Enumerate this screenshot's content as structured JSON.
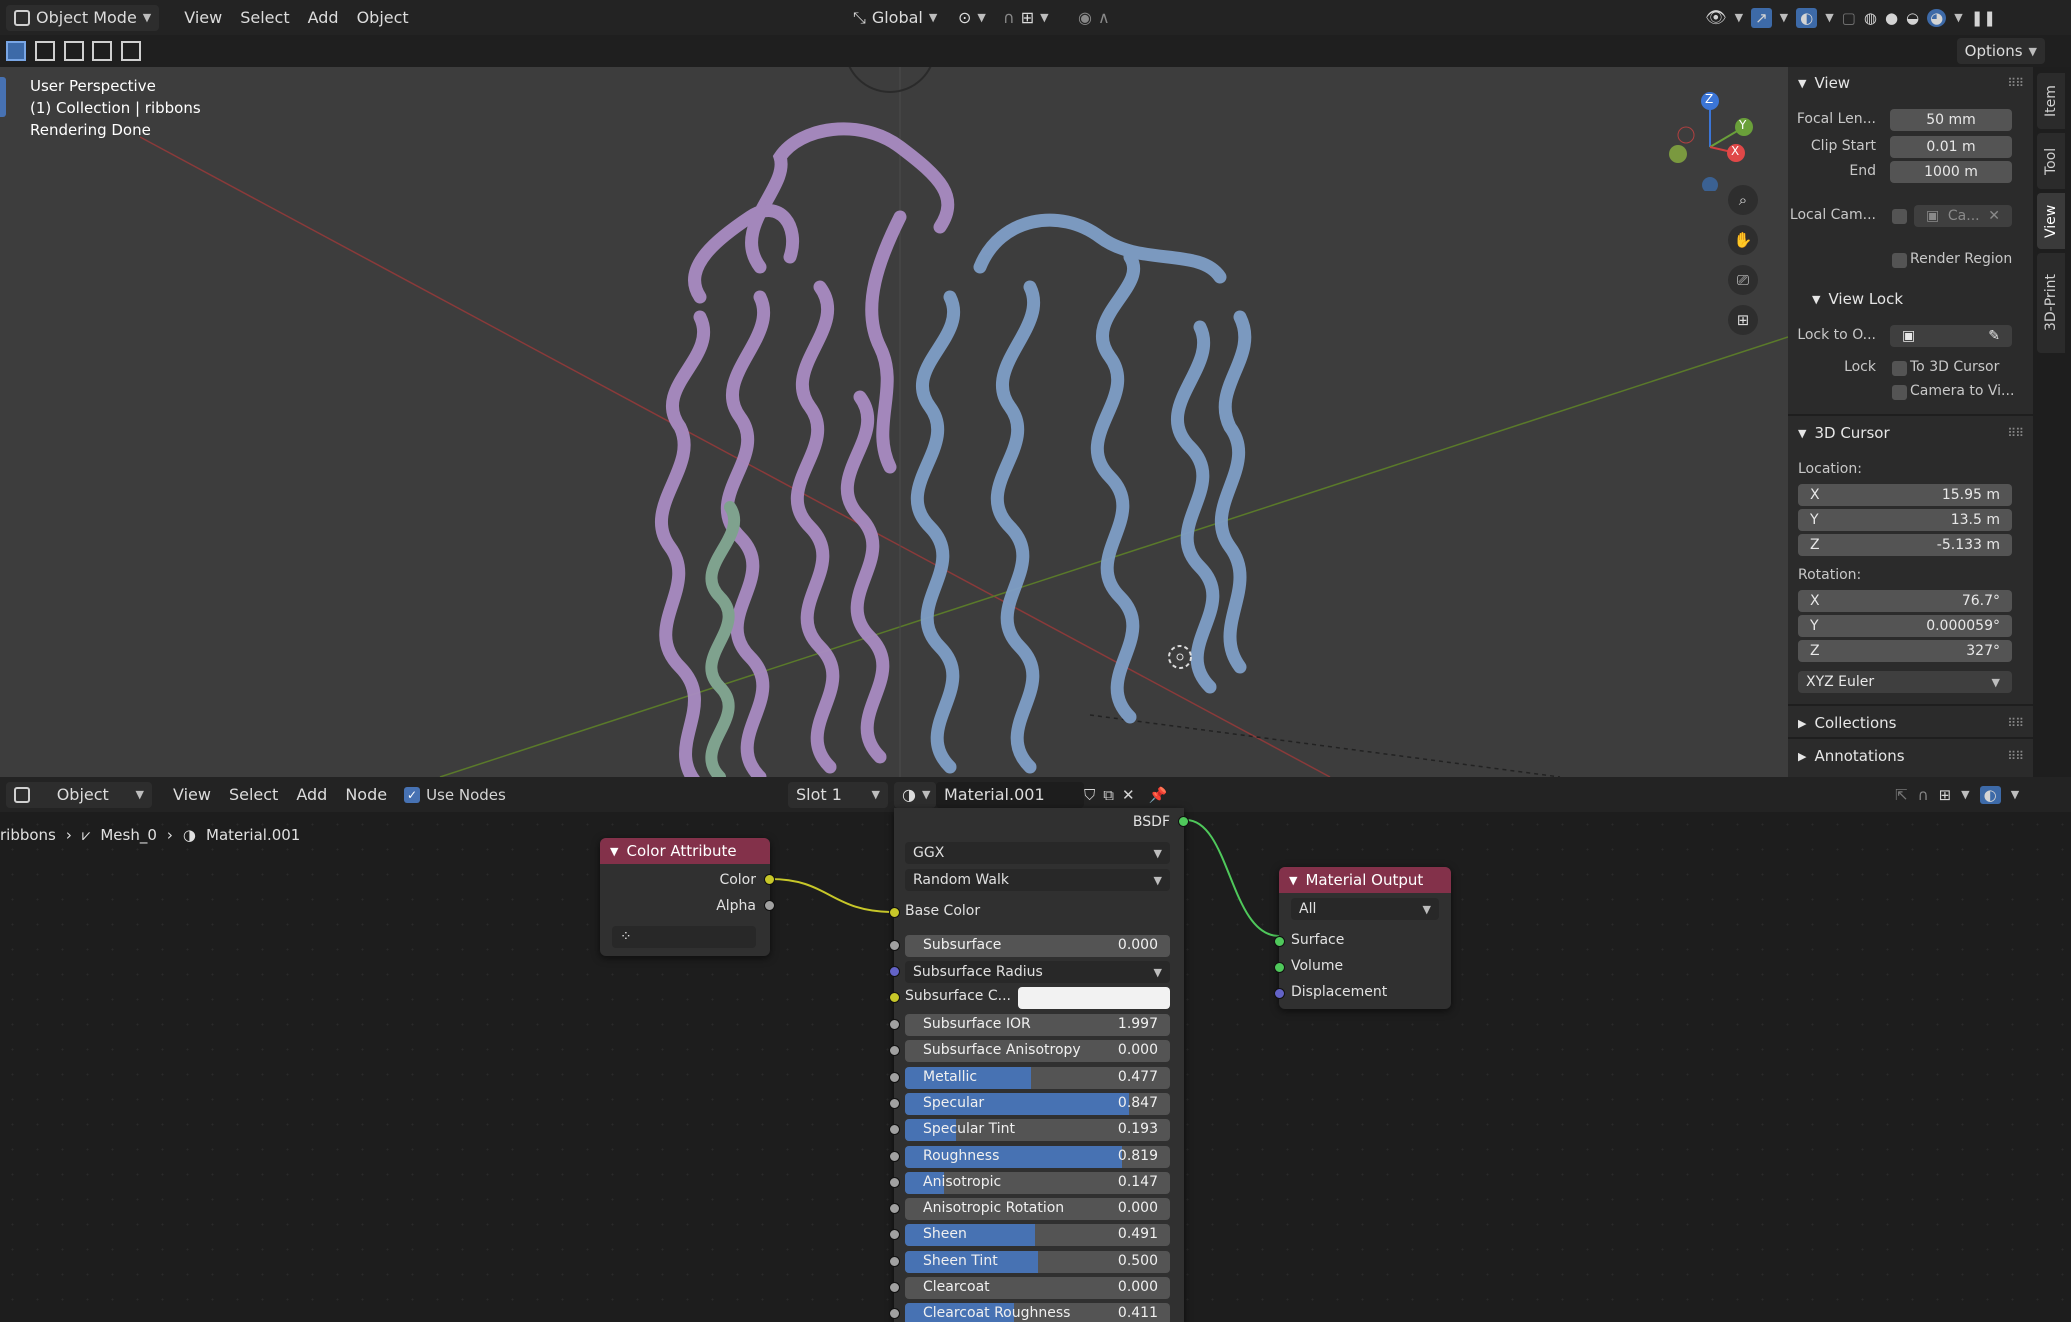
{
  "top_header": {
    "mode": "Object Mode",
    "menus": [
      "View",
      "Select",
      "Add",
      "Object"
    ],
    "transform_orientation": "Global",
    "options_label": "Options"
  },
  "viewport": {
    "overlay_lines": [
      "User Perspective",
      "(1) Collection | ribbons",
      "Rendering Done"
    ],
    "gizmo": {
      "z": "Z",
      "y": "Y",
      "x": "X"
    }
  },
  "side_tabs": [
    "Item",
    "Tool",
    "View",
    "3D-Print"
  ],
  "n_panel": {
    "view_header": "View",
    "focal_length_label": "Focal Len...",
    "focal_length": "50 mm",
    "clip_start_label": "Clip Start",
    "clip_start": "0.01 m",
    "clip_end_label": "End",
    "clip_end": "1000 m",
    "local_camera_label": "Local Cam...",
    "local_camera_value": "Ca...",
    "render_region_label": "Render Region",
    "view_lock_header": "View Lock",
    "lock_to_object_label": "Lock to O...",
    "lock_label": "Lock",
    "lock_to_3d_cursor": "To 3D Cursor",
    "camera_to_view": "Camera to Vi...",
    "cursor_header": "3D Cursor",
    "location_label": "Location:",
    "location": [
      {
        "axis": "X",
        "value": "15.95 m"
      },
      {
        "axis": "Y",
        "value": "13.5 m"
      },
      {
        "axis": "Z",
        "value": "-5.133 m"
      }
    ],
    "rotation_label": "Rotation:",
    "rotation": [
      {
        "axis": "X",
        "value": "76.7°"
      },
      {
        "axis": "Y",
        "value": "0.000059°"
      },
      {
        "axis": "Z",
        "value": "327°"
      }
    ],
    "rotation_mode": "XYZ Euler",
    "collections_header": "Collections",
    "annotations_header": "Annotations"
  },
  "node_header": {
    "mode": "Object",
    "menus": [
      "View",
      "Select",
      "Add",
      "Node"
    ],
    "use_nodes_label": "Use Nodes",
    "slot": "Slot 1",
    "material": "Material.001"
  },
  "breadcrumb": {
    "collection": "ribbons",
    "mesh": "Mesh_0",
    "material": "Material.001"
  },
  "color_attribute_node": {
    "title": "Color Attribute",
    "outputs": [
      "Color",
      "Alpha"
    ]
  },
  "bsdf_node": {
    "output": "BSDF",
    "distribution": "GGX",
    "subsurface_method": "Random Walk",
    "base_color_label": "Base Color",
    "subsurface_radius_label": "Subsurface Radius",
    "subsurface_color_label": "Subsurface C...",
    "sliders": [
      {
        "label": "Subsurface",
        "value": "0.000",
        "fill": 0.0
      },
      {
        "label": "Subsurface IOR",
        "value": "1.997",
        "fill": 0.0
      },
      {
        "label": "Subsurface Anisotropy",
        "value": "0.000",
        "fill": 0.0
      },
      {
        "label": "Metallic",
        "value": "0.477",
        "fill": 0.477
      },
      {
        "label": "Specular",
        "value": "0.847",
        "fill": 0.847
      },
      {
        "label": "Specular Tint",
        "value": "0.193",
        "fill": 0.193
      },
      {
        "label": "Roughness",
        "value": "0.819",
        "fill": 0.819
      },
      {
        "label": "Anisotropic",
        "value": "0.147",
        "fill": 0.147
      },
      {
        "label": "Anisotropic Rotation",
        "value": "0.000",
        "fill": 0.0
      },
      {
        "label": "Sheen",
        "value": "0.491",
        "fill": 0.491
      },
      {
        "label": "Sheen Tint",
        "value": "0.500",
        "fill": 0.5
      },
      {
        "label": "Clearcoat",
        "value": "0.000",
        "fill": 0.0
      },
      {
        "label": "Clearcoat Roughness",
        "value": "0.411",
        "fill": 0.411
      }
    ]
  },
  "material_output_node": {
    "title": "Material Output",
    "target": "All",
    "inputs": [
      "Surface",
      "Volume",
      "Displacement"
    ]
  },
  "colors": {
    "accent": "#4772b3",
    "color_attribute_header": "#83314a",
    "output_header": "#83314a",
    "socket_yellow": "#c7c729",
    "socket_green": "#4fc85b"
  }
}
